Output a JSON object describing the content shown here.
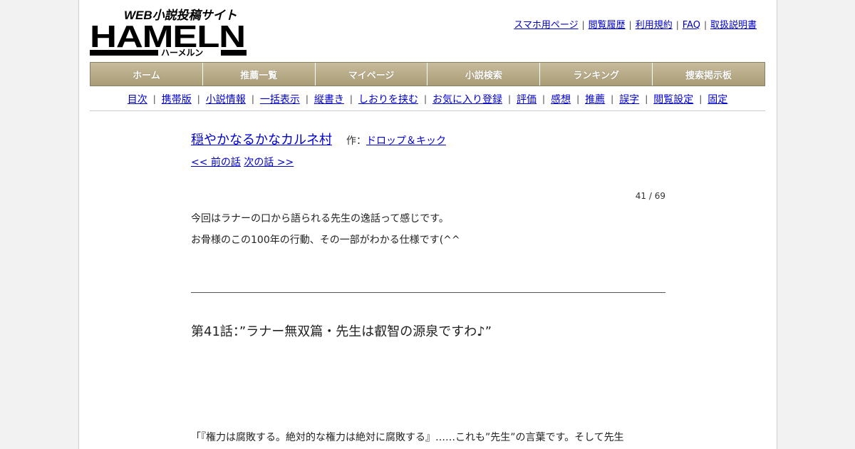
{
  "logo": {
    "tagline": "WEB小説投稿サイト",
    "brand": "HAMELN",
    "kana": "ハーメルン"
  },
  "header_links": [
    {
      "label": "スマホ用ページ"
    },
    {
      "label": "閲覧履歴"
    },
    {
      "label": "利用規約"
    },
    {
      "label": "FAQ"
    },
    {
      "label": "取扱説明書"
    }
  ],
  "global_nav": [
    {
      "label": "ホーム"
    },
    {
      "label": "推薦一覧"
    },
    {
      "label": "マイページ"
    },
    {
      "label": "小説検索"
    },
    {
      "label": "ランキング"
    },
    {
      "label": "捜索掲示板"
    }
  ],
  "sub_nav": [
    {
      "label": "目次"
    },
    {
      "label": "携帯版"
    },
    {
      "label": "小説情報"
    },
    {
      "label": "一括表示"
    },
    {
      "label": "縦書き"
    },
    {
      "label": "しおりを挟む"
    },
    {
      "label": "お気に入り登録"
    },
    {
      "label": "評価"
    },
    {
      "label": "感想"
    },
    {
      "label": "推薦"
    },
    {
      "label": "誤字"
    },
    {
      "label": "閲覧設定"
    },
    {
      "label": "固定"
    }
  ],
  "separator": "|",
  "novel": {
    "title": "穏やかなるかなカルネ村",
    "author_prefix": "作：",
    "author": "ドロップ＆キック"
  },
  "chapter_nav": {
    "prev": "<< 前の話",
    "next": "次の話 >>"
  },
  "page_counter": "41 / 69",
  "preface": [
    "今回はラナーの口から語られる先生の逸話って感じです。",
    "お骨様のこの100年の行動、その一部がわかる仕様です(^^"
  ],
  "chapter_title": "第41話：”ラナー無双篇・先生は叡智の源泉ですわ♪”",
  "body": [
    "「『権力は腐敗する。絶対的な権力は絶対に腐敗する』……これも”先生”の言葉です。そして先生"
  ]
}
